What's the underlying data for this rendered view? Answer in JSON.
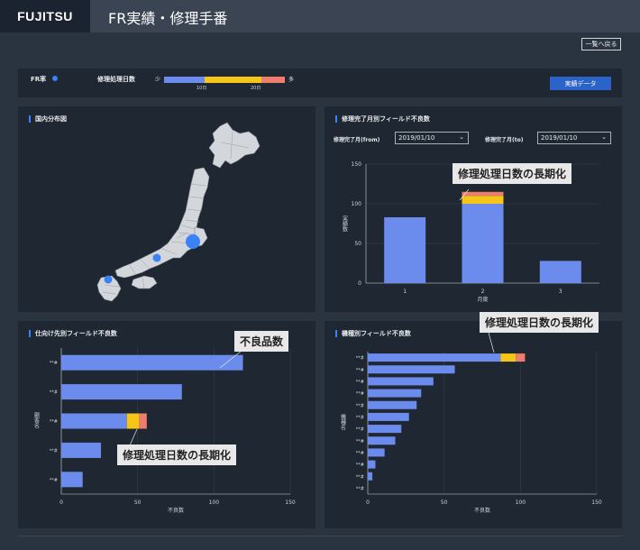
{
  "header": {
    "logo": "FUJITSU",
    "title": "FR実績・修理手番"
  },
  "back_button": "一覧へ戻る",
  "filter": {
    "fr_label": "FR率",
    "days_label": "修理処理日数",
    "legend_min": "少",
    "legend_max": "多",
    "tick_10": "10日",
    "tick_20": "20日",
    "data_button": "実績データ",
    "colors": {
      "blue": "#6b8cec",
      "yellow": "#f5c518",
      "red": "#ef7d6b"
    }
  },
  "map_panel": {
    "title": "国内分布図",
    "marker_color": "#3b82f6"
  },
  "month_panel": {
    "title": "修理完了月別フィールド不良数",
    "from_label": "修理完了月(from)",
    "from_value": "2019/01/10",
    "to_label": "修理完了月(to)",
    "to_value": "2019/01/10",
    "callout": "修理処理日数の長期化"
  },
  "dest_panel": {
    "title": "仕向け先別フィールド不良数",
    "callout_top": "不良品数",
    "callout_bottom": "修理処理日数の長期化"
  },
  "model_panel": {
    "title": "機種別フィールド不良数",
    "callout": "修理処理日数の長期化"
  },
  "chart_data": [
    {
      "type": "bar",
      "title": "修理完了月別フィールド不良数",
      "categories": [
        "1",
        "2",
        "3"
      ],
      "series": [
        {
          "values": [
            83,
            100,
            28
          ]
        },
        {
          "values": [
            0,
            10,
            0
          ]
        },
        {
          "values": [
            0,
            5,
            0
          ]
        }
      ],
      "stacked": true,
      "xlabel": "月度",
      "ylabel": "実績数",
      "yticks": [
        "0",
        "50",
        "100",
        "150"
      ],
      "ylim": [
        0,
        150
      ],
      "grid": true
    },
    {
      "type": "bar",
      "orientation": "horizontal",
      "title": "仕向け先別フィールド不良数",
      "categories": [
        "**#",
        "**#",
        "**#",
        "**#",
        "**#"
      ],
      "series": [
        {
          "values": [
            119,
            79,
            43,
            26,
            14
          ]
        },
        {
          "values": [
            0,
            0,
            8,
            0,
            0
          ]
        },
        {
          "values": [
            0,
            0,
            5,
            0,
            0
          ]
        }
      ],
      "stacked": true,
      "xlabel": "不良数",
      "ylabel": "顧客名",
      "xticks": [
        "0",
        "50",
        "100",
        "150"
      ],
      "xlim": [
        0,
        150
      ],
      "grid": true
    },
    {
      "type": "bar",
      "orientation": "horizontal",
      "title": "機種別フィールド不良数",
      "categories": [
        "**#",
        "**#",
        "**#",
        "**#",
        "**#",
        "**#",
        "**#",
        "**#",
        "**#",
        "**#",
        "**#",
        "**#"
      ],
      "series": [
        {
          "values": [
            87,
            57,
            43,
            35,
            32,
            27,
            22,
            18,
            11,
            5,
            3,
            0
          ]
        },
        {
          "values": [
            10,
            0,
            0,
            0,
            0,
            0,
            0,
            0,
            0,
            0,
            0,
            0
          ]
        },
        {
          "values": [
            6,
            0,
            0,
            0,
            0,
            0,
            0,
            0,
            0,
            0,
            0,
            0
          ]
        }
      ],
      "stacked": true,
      "xlabel": "不良数",
      "ylabel": "機種名",
      "xticks": [
        "0",
        "50",
        "100",
        "150"
      ],
      "xlim": [
        0,
        150
      ],
      "grid": true
    }
  ]
}
